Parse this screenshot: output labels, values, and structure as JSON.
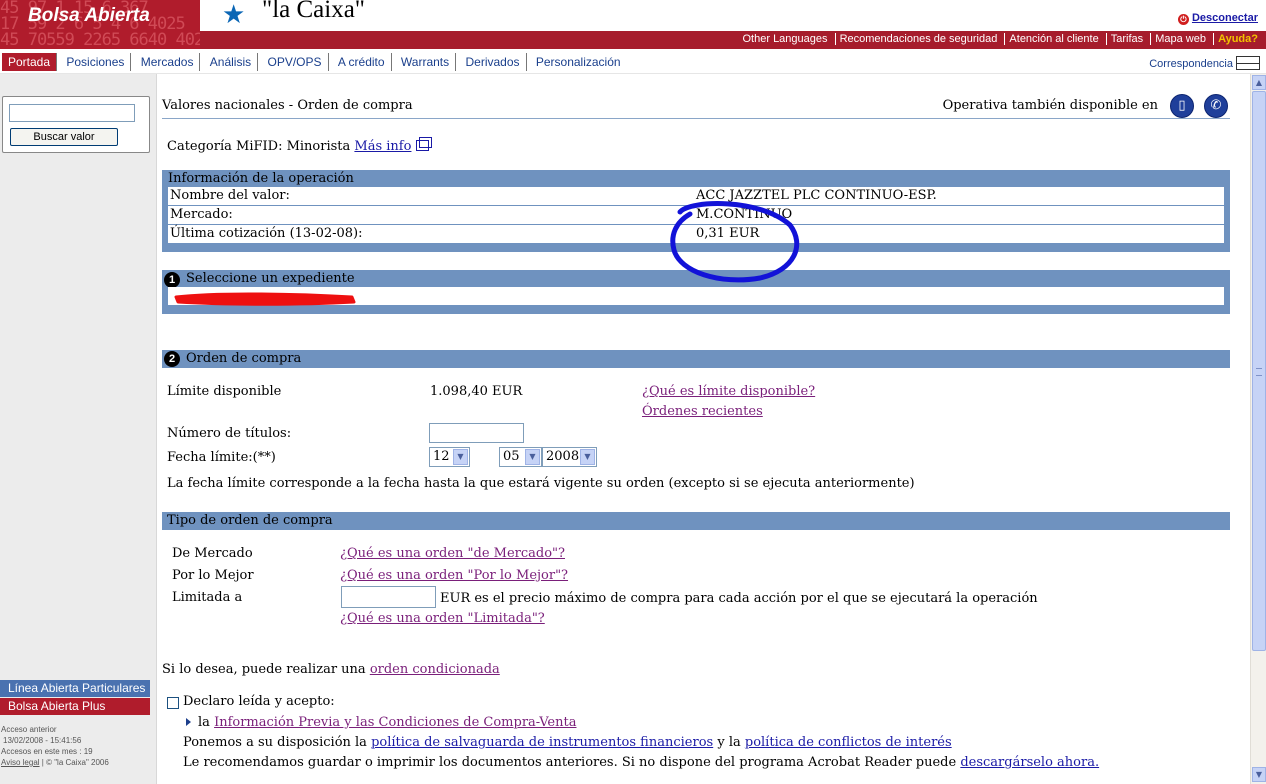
{
  "header": {
    "brand": "Bolsa Abierta",
    "brand_bg_digits": "45 97 1 15 6 367\n17 59 2 6 5 4 6 4025\n45 70559 2265 6640 4025",
    "logo_text": "\"la Caixa\"",
    "logout_label": "Desconectar"
  },
  "topbar": {
    "items": [
      "Other Languages",
      "Recomendaciones de seguridad",
      "Atención al cliente",
      "Tarifas",
      "Mapa web"
    ],
    "help_label": "Ayuda?"
  },
  "nav": {
    "items": [
      "Portada",
      "Posiciones",
      "Mercados",
      "Análisis",
      "OPV/OPS",
      "A crédito",
      "Warrants",
      "Derivados",
      "Personalización"
    ],
    "active_index": 0,
    "correspondencia": "Correspondencia"
  },
  "sidebar": {
    "search_placeholder": "",
    "search_button": "Buscar valor",
    "link_linea": "Línea Abierta Particulares",
    "link_plus": "Bolsa Abierta Plus",
    "meta_label_1": "Acceso anterior",
    "meta_value_1": "13/02/2008 - 15:41:56",
    "meta_label_2": "Accesos en este mes : 19",
    "aviso": "Aviso legal",
    "copyright": "| © \"la Caixa\" 2006"
  },
  "page": {
    "title": "Valores nacionales - Orden de compra",
    "also_available": "Operativa también disponible en",
    "mifid_label": "Categoría MiFID: Minorista",
    "mifid_link": "Más info"
  },
  "operation": {
    "header": "Información de la operación",
    "rows": [
      {
        "label": "Nombre del valor:",
        "value": "ACC JAZZTEL PLC CONTINUO-ESP."
      },
      {
        "label": "Mercado:",
        "value": "M.CONTINUO"
      },
      {
        "label": "Última cotización (13-02-08):",
        "value": "0,31 EUR"
      }
    ]
  },
  "expediente": {
    "step": "1",
    "header": "Seleccione un expediente"
  },
  "orden": {
    "step": "2",
    "header": "Orden de compra",
    "limite_label": "Límite disponible",
    "limite_value": "1.098,40 EUR",
    "limite_link": "¿Qué es límite disponible?",
    "recientes_link": "Órdenes recientes",
    "titulos_label": "Número de títulos:",
    "titulos_value": "",
    "fecha_label": "Fecha límite:(**)",
    "fecha_day": "12",
    "fecha_month": "05",
    "fecha_year": "2008",
    "fecha_note": "La fecha límite corresponde a la fecha hasta la que estará vigente su orden (excepto si se ejecuta anteriormente)"
  },
  "tipo": {
    "header": "Tipo de orden de compra",
    "mercado_label": "De Mercado",
    "mercado_link": "¿Qué es una orden \"de Mercado\"?",
    "mejor_label": "Por lo Mejor",
    "mejor_link": "¿Qué es una orden \"Por lo Mejor\"?",
    "limitada_label": "Limitada a",
    "limitada_value": "",
    "limitada_note": "EUR es el precio máximo de compra para cada acción por el que se ejecutará la operación",
    "limitada_link": "¿Qué es una orden \"Limitada\"?"
  },
  "footer": {
    "condicionada_text": "Si lo desea, puede realizar una",
    "condicionada_link": "orden condicionada",
    "declaro": "Declaro leída y acepto:",
    "la": "la",
    "info_link": "Información Previa y las Condiciones de Compra-Venta",
    "ponemos": "Ponemos a su disposición la",
    "salvaguarda_link": "política de salvaguarda de instrumentos financieros",
    "y_la": "y la",
    "conflictos_link": "política de conflictos de interés",
    "recomendamos": "Le recomendamos guardar o imprimir los documentos anteriores. Si no dispone del programa Acrobat Reader puede",
    "descargar_link": "descargárselo ahora."
  },
  "colors": {
    "brand_red": "#b01c2c",
    "panel_blue": "#6f92bf",
    "annotation_blue": "#1212d8",
    "annotation_red": "#ee1010"
  }
}
